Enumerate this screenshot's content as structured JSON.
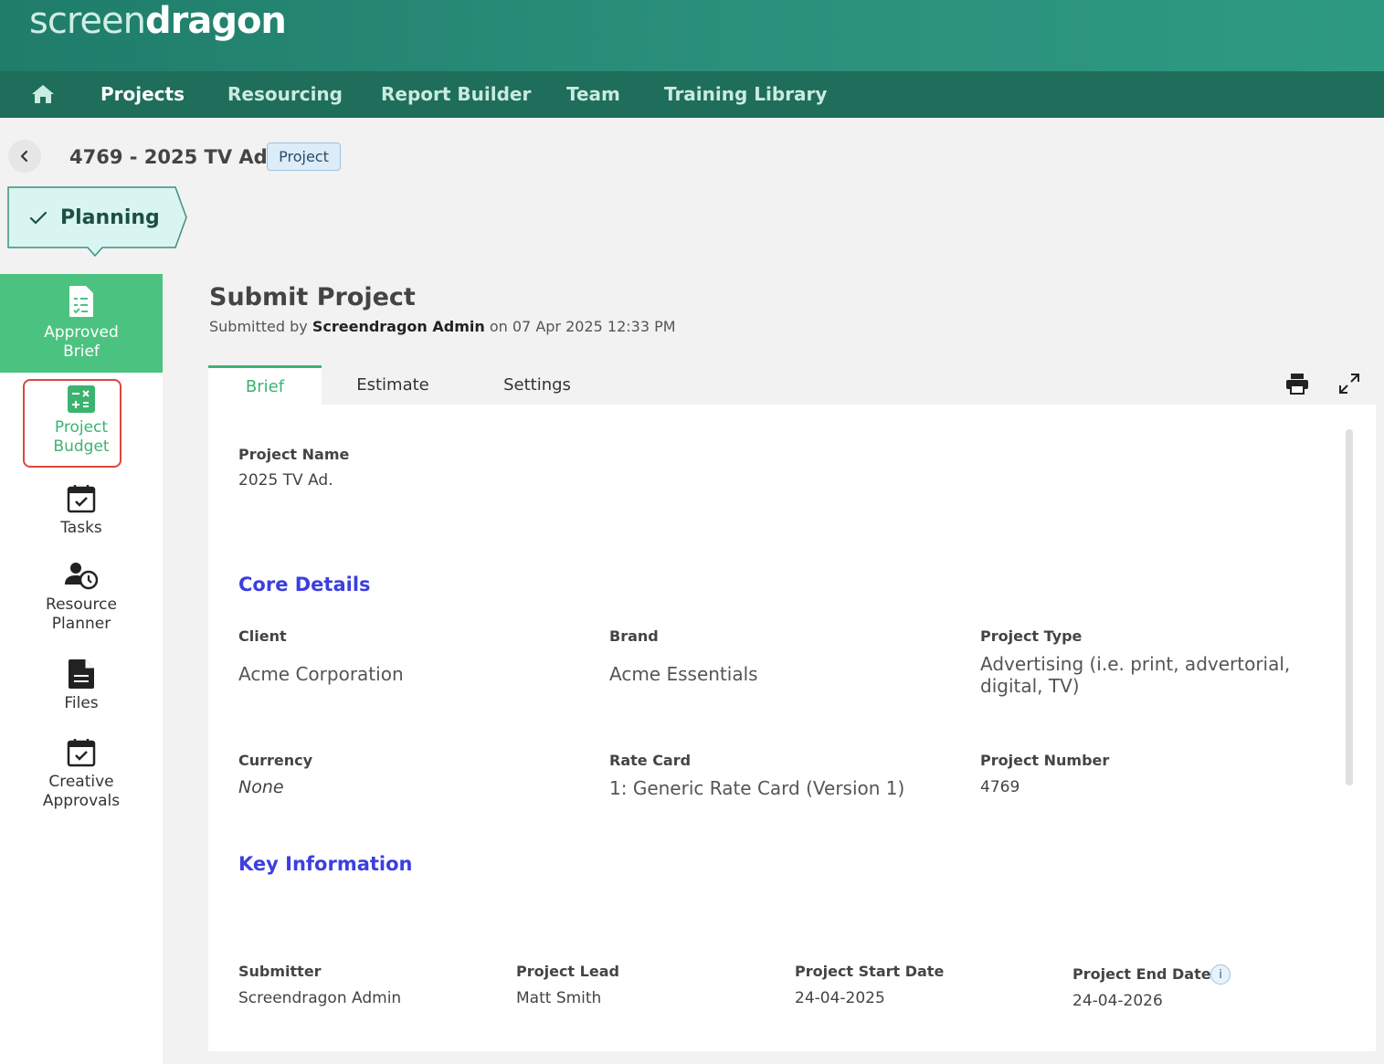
{
  "brand": {
    "logo_part1": "screen",
    "logo_part2": "dragon"
  },
  "nav": {
    "items": [
      {
        "label": "Projects",
        "active": true
      },
      {
        "label": "Resourcing"
      },
      {
        "label": "Report Builder"
      },
      {
        "label": "Team"
      },
      {
        "label": "Training Library"
      }
    ]
  },
  "header": {
    "project_title": "4769 - 2025 TV Ad.",
    "badge": "Project"
  },
  "stage": {
    "label": "Planning"
  },
  "sidebar": {
    "items": [
      {
        "label": "Approved Brief"
      },
      {
        "label": "Project Budget"
      },
      {
        "label": "Tasks"
      },
      {
        "label": "Resource Planner"
      },
      {
        "label": "Files"
      },
      {
        "label": "Creative Approvals"
      }
    ]
  },
  "main": {
    "title": "Submit Project",
    "submitted_prefix": "Submitted by",
    "submitted_by": "Screendragon Admin",
    "submitted_on": "on 07 Apr 2025 12:33 PM",
    "tabs": [
      {
        "label": "Brief"
      },
      {
        "label": "Estimate"
      },
      {
        "label": "Settings"
      }
    ]
  },
  "brief": {
    "project_name_label": "Project Name",
    "project_name": "2025 TV Ad.",
    "core_details": "Core Details",
    "client_label": "Client",
    "client": "Acme Corporation",
    "brand_label": "Brand",
    "brand": "Acme Essentials",
    "project_type_label": "Project Type",
    "project_type_line1": "Advertising (i.e. print, advertorial,",
    "project_type_line2": "digital, TV)",
    "currency_label": "Currency",
    "currency": "None",
    "rate_card_label": "Rate Card",
    "rate_card": "1: Generic Rate Card (Version 1)",
    "project_number_label": "Project Number",
    "project_number": "4769",
    "key_information": "Key Information",
    "submitter_label": "Submitter",
    "submitter": "Screendragon Admin",
    "project_lead_label": "Project Lead",
    "project_lead": "Matt Smith",
    "start_date_label": "Project Start Date",
    "start_date": "24-04-2025",
    "end_date_label": "Project End Date",
    "end_date": "24-04-2026",
    "info_glyph": "i"
  }
}
